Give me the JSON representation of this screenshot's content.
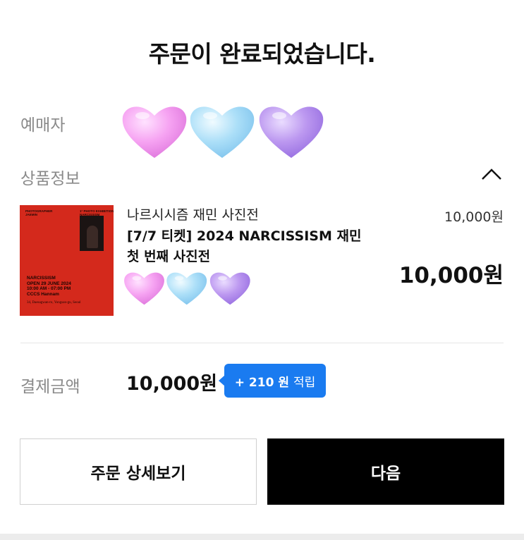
{
  "page": {
    "title": "주문이 완료되었습니다."
  },
  "orderer": {
    "label": "예매자",
    "name_obscured_by": "heart-stickers"
  },
  "product": {
    "section_label": "상품정보",
    "toggle_icon": "chevron-up-icon",
    "name": "나르시시즘 재민 사진전",
    "description": "[7/7 티켓] 2024 NARCISSISM 재민 첫 번째 사진전",
    "unit_price": "10,000원",
    "total_price": "10,000원",
    "thumbnail": {
      "top_left": "PHOTOGRAPHER\nJAEMIN",
      "top_right": "1° PHOTO EXHIBITION\nNARCISSISM",
      "main_text": "NARCISSISM\nOPEN 29 JUNE 2024\n10:00 AM - 07:00 PM\nCCCS Hannam",
      "address": "34, Daesagwan-ro, Yongsan-gu, Seoul",
      "background": "#d4291c"
    }
  },
  "payment": {
    "label": "결제금액",
    "amount": "10,000원",
    "points_amount": "+ 210 원",
    "points_suffix": "적립",
    "accent": "#1a7bf0"
  },
  "buttons": {
    "detail_label": "주문 상세보기",
    "next_label": "다음"
  },
  "heart_colors": [
    "#f59ef0",
    "#a9dff7",
    "#b893ef"
  ]
}
